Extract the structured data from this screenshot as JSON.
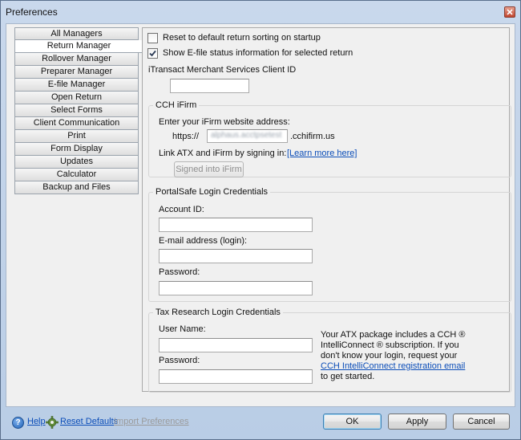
{
  "window": {
    "title": "Preferences"
  },
  "nav": {
    "items": [
      {
        "label": "All Managers"
      },
      {
        "label": "Return Manager"
      },
      {
        "label": "Rollover Manager"
      },
      {
        "label": "Preparer Manager"
      },
      {
        "label": "E-file Manager"
      },
      {
        "label": "Open Return"
      },
      {
        "label": "Select Forms"
      },
      {
        "label": "Client Communication"
      },
      {
        "label": "Print"
      },
      {
        "label": "Form Display"
      },
      {
        "label": "Updates"
      },
      {
        "label": "Calculator"
      },
      {
        "label": "Backup and Files"
      }
    ],
    "active_index": 1
  },
  "options": {
    "reset_sorting": {
      "label": "Reset to default return sorting on startup",
      "checked": false
    },
    "show_efile": {
      "label": "Show E-file status information for selected return",
      "checked": true
    }
  },
  "itransact": {
    "label": "iTransact Merchant Services Client ID",
    "value": ""
  },
  "ifirm": {
    "group_title": "CCH iFirm",
    "address_label": "Enter your iFirm website address:",
    "prefix": "https://",
    "subdomain": "alphaus.acctpsetest",
    "suffix": ".cchifirm.us",
    "link_label": "Link ATX and iFirm by signing in:",
    "learn_more": "[Learn more here]",
    "signed_in_button": "Signed into iFirm"
  },
  "portalsafe": {
    "group_title": "PortalSafe Login Credentials",
    "account_label": "Account ID:",
    "account_value": "",
    "email_label": "E-mail address (login):",
    "email_value": "",
    "password_label": "Password:",
    "password_value": ""
  },
  "taxresearch": {
    "group_title": "Tax Research Login Credentials",
    "user_label": "User Name:",
    "user_value": "",
    "password_label": "Password:",
    "password_value": "",
    "info_line1": "Your ATX package includes a CCH ®",
    "info_line2": "IntelliConnect ® subscription. If you",
    "info_line3": "don't know your login, request your",
    "info_link": "CCH IntelliConnect registration email",
    "info_line5": "to get started."
  },
  "footer": {
    "help": "Help",
    "reset_defaults": "Reset Defaults",
    "import_prefs": "Import Preferences",
    "ok": "OK",
    "apply": "Apply",
    "cancel": "Cancel"
  }
}
